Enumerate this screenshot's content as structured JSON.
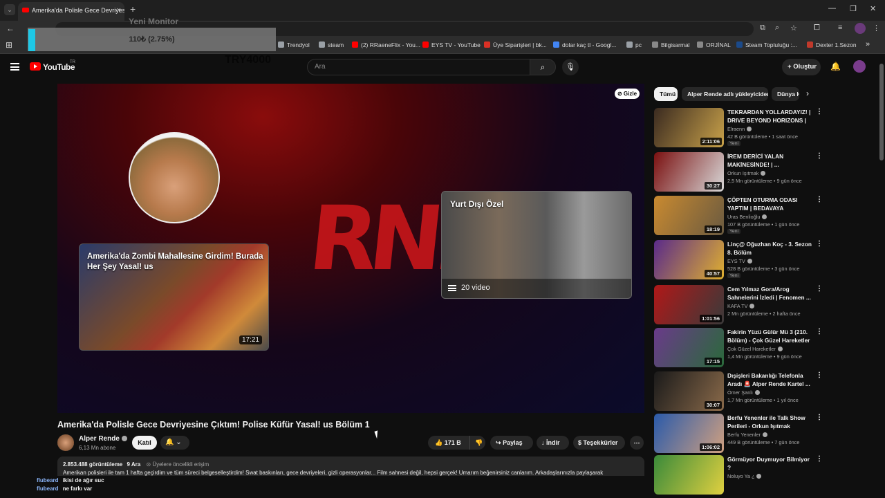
{
  "browser": {
    "tab_title": "Amerika'da Polisle Gece Devriyesi",
    "new_tab_icon": "plus-icon",
    "bookmarks": [
      {
        "label": "Trendyol",
        "color": "#9aa0a6"
      },
      {
        "label": "steam",
        "color": "#9aa0a6"
      },
      {
        "label": "(2) RRaeneFlix - You...",
        "color": "#ff0000"
      },
      {
        "label": "EYS TV - YouTube",
        "color": "#ff0000"
      },
      {
        "label": "Üye Siparişleri | bk...",
        "color": "#d93025"
      },
      {
        "label": "dolar kaç tl - Googl...",
        "color": "#4285f4"
      },
      {
        "label": "pc",
        "color": "#9aa0a6"
      },
      {
        "label": "Bilgisarmal",
        "color": "#888888"
      },
      {
        "label": "ORJİNAL",
        "color": "#888888"
      },
      {
        "label": "Steam Topluluğu :...",
        "color": "#1b4a8a"
      },
      {
        "label": "Dexter 1.Sezon",
        "color": "#c0392b"
      }
    ]
  },
  "overlay": {
    "ghost_title": "Yeni Monitor",
    "price": "110₺ (2.75%)",
    "ghost_amount": "TRY4000"
  },
  "youtube": {
    "logo_text": "YouTube",
    "region": "TR",
    "search_placeholder": "Ara",
    "create_label": "Oluştur"
  },
  "player": {
    "hide_label": "Gizle",
    "card1_title": "Amerika'da Zombi Mahallesine Girdim! Burada Her Şey Yasal! us",
    "card1_duration": "17:21",
    "card2_title": "Yurt Dışı Özel",
    "card2_count": "20 video",
    "logo_text": "RND"
  },
  "video": {
    "title": "Amerika'da Polisle Gece Devriyesine Çıktım! Polise Küfür Yasal! us Bölüm 1",
    "channel": "Alper Rende",
    "subscribers": "6,13 Mn abone",
    "join_label": "Katıl",
    "likes": "171 B",
    "share_label": "Paylaş",
    "download_label": "İndir",
    "thanks_label": "Teşekkürler",
    "views": "2.853.488 görüntüleme",
    "date": "9 Ara",
    "members": "Üyelere öncelikli erişim",
    "description": "Amerikan polisleri ile tam 1 hafta geçirdim ve tüm süreci belgeselleştirdim! Swat baskınları, gece devriyeleri, gizli operasyonlar... Film sahnesi değil, hepsi gerçek! Umarım beğenirsiniz canlarım. Arkadaşlarınızla paylaşarak"
  },
  "chips": [
    "Tümü",
    "Alper Rende adlı yükleyiciden",
    "Dünya Ha"
  ],
  "recommendations": [
    {
      "title": "TEKRARDAN YOLLARDAYIZ! | DRIVE BEYOND HORIZONS | S...",
      "channel": "Elraenn",
      "views": "42 B görüntüleme",
      "age": "1 saat önce",
      "badge": "Yeni",
      "duration": "2:11:06",
      "color1": "#3a2a20",
      "color2": "#c9a24a"
    },
    {
      "title": "İREM DERİCİ YALAN MAKİNESİNDE! | ...",
      "channel": "Orkun Işıtmak",
      "views": "2,5 Mn görüntüleme",
      "age": "9 gün önce",
      "badge": "",
      "duration": "30:27",
      "color1": "#7a1010",
      "color2": "#d8d8d8"
    },
    {
      "title": "ÇÖPTEN OTURMA ODASI YAPTIM | BEDAVAYA",
      "channel": "Uras Benlioğlu",
      "views": "107 B görüntüleme",
      "age": "1 gün önce",
      "badge": "Yeni",
      "duration": "18:19",
      "color1": "#c98a30",
      "color2": "#6a5a40"
    },
    {
      "title": "Linç@ Oğuzhan Koç - 3. Sezon 8. Bölüm",
      "channel": "EYS TV",
      "views": "528 B görüntüleme",
      "age": "3 gün önce",
      "badge": "Yeni",
      "duration": "40:57",
      "color1": "#5a2a8a",
      "color2": "#e0b030"
    },
    {
      "title": "Cem Yılmaz Gora/Arog Sahnelerini İzledi | Fenomen ...",
      "channel": "KAFA TV",
      "views": "2 Mn görüntüleme",
      "age": "2 hafta önce",
      "badge": "",
      "duration": "1:01:56",
      "color1": "#b01818",
      "color2": "#3a3a3a"
    },
    {
      "title": "Fakirin Yüzü Gülür Mü 3 (210. Bölüm) - Çok Güzel Hareketler 2",
      "channel": "Çok Güzel Hareketler",
      "views": "1,4 Mn görüntüleme",
      "age": "9 gün önce",
      "badge": "",
      "duration": "17:15",
      "color1": "#6a3a8a",
      "color2": "#2a6a3a"
    },
    {
      "title": "Dışişleri Bakanlığı Telefonla Aradı 🚨 Alper Rende Kartel ...",
      "channel": "Ömer Şanlı",
      "views": "1,7 Mn görüntüleme",
      "age": "1 yıl önce",
      "badge": "",
      "duration": "30:07",
      "color1": "#1a1a1a",
      "color2": "#8a6a4a"
    },
    {
      "title": "Berfu Yenenler ile Talk Show Perileri - Orkun Işıtmak",
      "channel": "Berfu Yenenler",
      "views": "449 B görüntüleme",
      "age": "7 gün önce",
      "badge": "",
      "duration": "1:06:02",
      "color1": "#2a5aaa",
      "color2": "#d0a080"
    },
    {
      "title": "Görmüyor Duymuyor Bilmiyor ?",
      "channel": "Noluyo Ya ¿",
      "views": "",
      "age": "",
      "badge": "",
      "duration": "",
      "color1": "#3a8a3a",
      "color2": "#e0d040"
    }
  ],
  "chat": [
    {
      "user": "flubeard",
      "text": "ikisi de ağır suc"
    },
    {
      "user": "flubeard",
      "text": "ne farkı var"
    }
  ]
}
